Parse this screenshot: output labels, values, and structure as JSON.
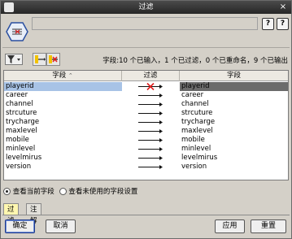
{
  "window": {
    "title": "过滤"
  },
  "header": {
    "node_name": ""
  },
  "toolbar": {
    "status": "字段:10 个已输入，1 个已过滤，0 个已重命名，9 个已输出"
  },
  "table": {
    "columns": [
      "字段",
      "过滤",
      "字段"
    ],
    "sort_indicator": "⌃",
    "rows": [
      {
        "in": "playerid",
        "out": "playerid",
        "filtered": true
      },
      {
        "in": "career",
        "out": "career",
        "filtered": false
      },
      {
        "in": "channel",
        "out": "channel",
        "filtered": false
      },
      {
        "in": "strcuture",
        "out": "strcuture",
        "filtered": false
      },
      {
        "in": "trycharge",
        "out": "trycharge",
        "filtered": false
      },
      {
        "in": "maxlevel",
        "out": "maxlevel",
        "filtered": false
      },
      {
        "in": "mobile",
        "out": "mobile",
        "filtered": false
      },
      {
        "in": "minlevel",
        "out": "minlevel",
        "filtered": false
      },
      {
        "in": "levelmirus",
        "out": "levelmirus",
        "filtered": false
      },
      {
        "in": "version",
        "out": "version",
        "filtered": false
      }
    ]
  },
  "view_options": {
    "current": "查看当前字段",
    "unused": "查看未使用的字段设置",
    "selected": "current"
  },
  "tabs": [
    {
      "label": "过滤",
      "active": true
    },
    {
      "label": "注解",
      "active": false
    }
  ],
  "buttons": {
    "ok": "确定",
    "cancel": "取消",
    "apply": "应用",
    "reset": "重置"
  },
  "colors": {
    "title_bar": "#2f2f2f",
    "selected_row": "#a8c3e6",
    "selected_output": "#6b6b6b",
    "active_tab": "#fff7b0",
    "filter_cross": "#e02020"
  },
  "icons": [
    "filter-node-icon",
    "help-icon",
    "question-icon",
    "close-icon",
    "filter-dropdown-icon",
    "pass-all-icon",
    "filter-all-icon",
    "arrow-icon",
    "cross-arrow-icon"
  ]
}
